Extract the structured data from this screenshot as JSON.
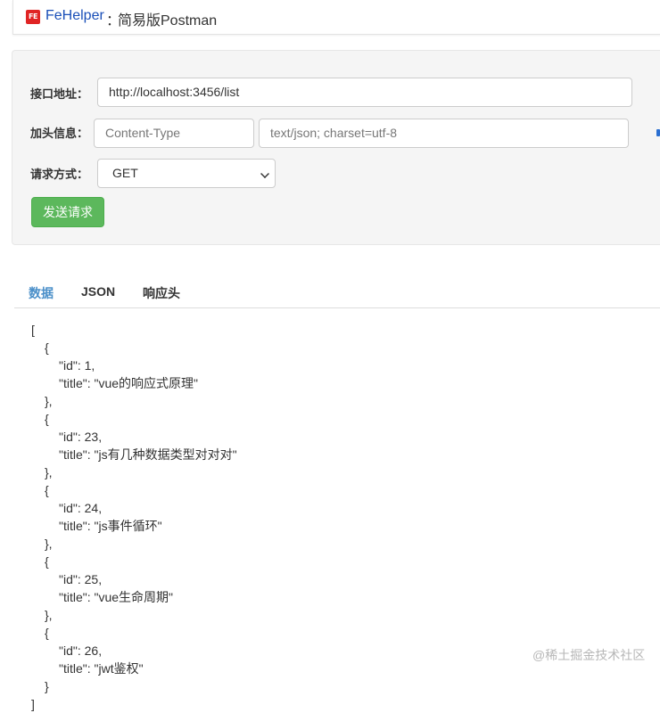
{
  "header": {
    "logo_text": "FE",
    "app_name": "FeHelper",
    "separator": "：",
    "tool_title": "简易版Postman"
  },
  "request": {
    "url_label": "接口地址：",
    "url_value": "http://localhost:3456/list",
    "header_label": "加头信息：",
    "header_name_placeholder": "Content-Type",
    "header_value_placeholder": "text/json; charset=utf-8",
    "method_label": "请求方式：",
    "method_value": "GET",
    "send_label": "发送请求"
  },
  "tabs": [
    {
      "label": "数据",
      "active": true
    },
    {
      "label": "JSON",
      "active": false
    },
    {
      "label": "响应头",
      "active": false
    }
  ],
  "response": [
    {
      "id": 1,
      "title": "vue的响应式原理"
    },
    {
      "id": 23,
      "title": "js有几种数据类型对对对"
    },
    {
      "id": 24,
      "title": "js事件循环"
    },
    {
      "id": 25,
      "title": "vue生命周期"
    },
    {
      "id": 26,
      "title": "jwt鉴权"
    }
  ],
  "watermark": "@稀土掘金技术社区",
  "colors": {
    "brand": "#1a4fb8",
    "send_button": "#5cb85c",
    "active_tab": "#4a8fc9"
  }
}
